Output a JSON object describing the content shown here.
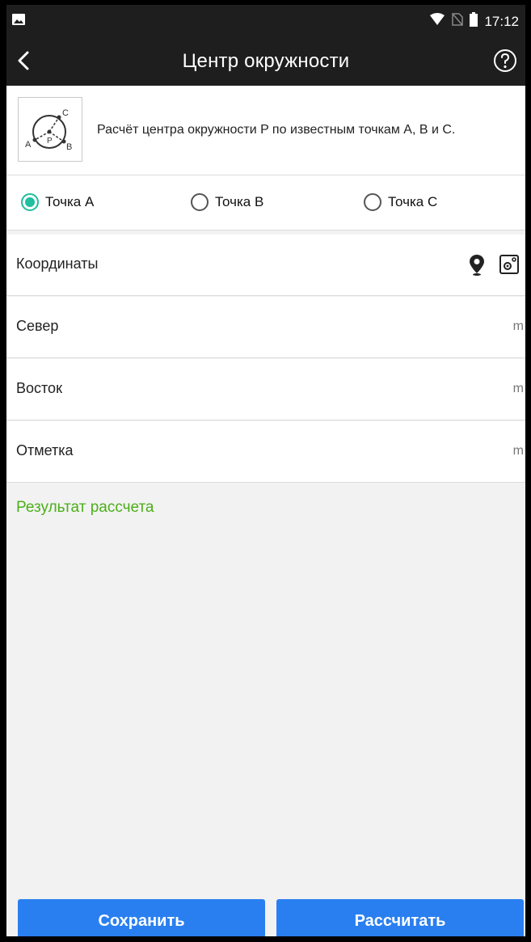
{
  "status_bar": {
    "time": "17:12"
  },
  "app_bar": {
    "title": "Центр окружности"
  },
  "info": {
    "description": "Расчёт центра окружности P по известным точкам A, B и C.",
    "diagram_labels": {
      "a": "A",
      "b": "B",
      "c": "C",
      "p": "P"
    }
  },
  "point_options": [
    {
      "label": "Точка A",
      "checked": true
    },
    {
      "label": "Точка B",
      "checked": false
    },
    {
      "label": "Точка C",
      "checked": false
    }
  ],
  "coordinates": {
    "label": "Координаты",
    "icons": [
      "location-pin-icon",
      "map-point-icon"
    ]
  },
  "fields": [
    {
      "label": "Север",
      "unit": "m",
      "value": ""
    },
    {
      "label": "Восток",
      "unit": "m",
      "value": ""
    },
    {
      "label": "Отметка",
      "unit": "m",
      "value": ""
    }
  ],
  "result": {
    "label": "Результат рассчета"
  },
  "buttons": {
    "save": "Сохранить",
    "calculate": "Рассчитать"
  },
  "colors": {
    "accent": "#1fbf9f",
    "primary": "#2a7ff0",
    "result": "#4caf1a",
    "bar": "#1e1e1e"
  }
}
